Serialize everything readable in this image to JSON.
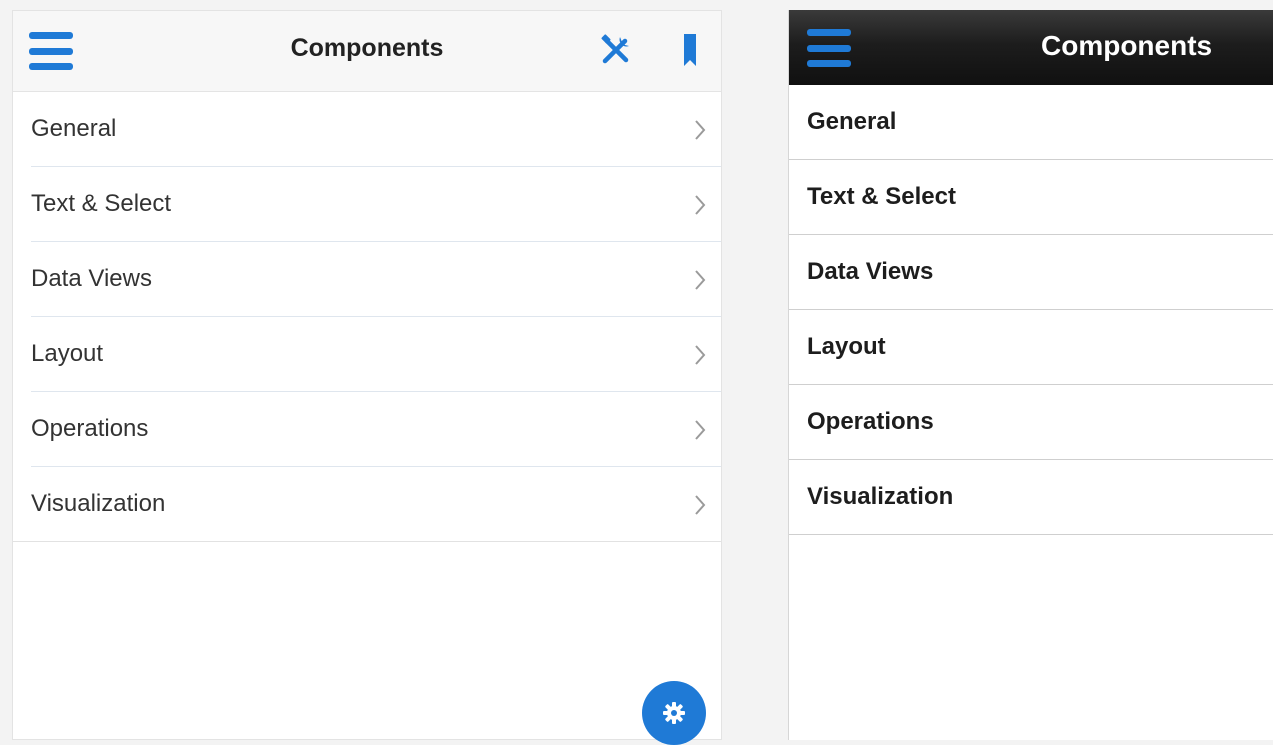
{
  "light_panel": {
    "header": {
      "title": "Components",
      "menu_icon": "hamburger-menu-icon",
      "tools_icon": "tools-icon",
      "bookmark_icon": "bookmark-icon"
    },
    "items": [
      {
        "label": "General"
      },
      {
        "label": "Text & Select"
      },
      {
        "label": "Data Views"
      },
      {
        "label": "Layout"
      },
      {
        "label": "Operations"
      },
      {
        "label": "Visualization"
      }
    ],
    "fab_icon": "gear-icon"
  },
  "dark_panel": {
    "header": {
      "title": "Components",
      "menu_icon": "hamburger-menu-icon"
    },
    "items": [
      {
        "label": "General"
      },
      {
        "label": "Text & Select"
      },
      {
        "label": "Data Views"
      },
      {
        "label": "Layout"
      },
      {
        "label": "Operations"
      },
      {
        "label": "Visualization"
      }
    ]
  },
  "colors": {
    "accent": "#1f7ad6",
    "dark_header": "#1d1d1d",
    "light_header": "#f7f7f7"
  }
}
